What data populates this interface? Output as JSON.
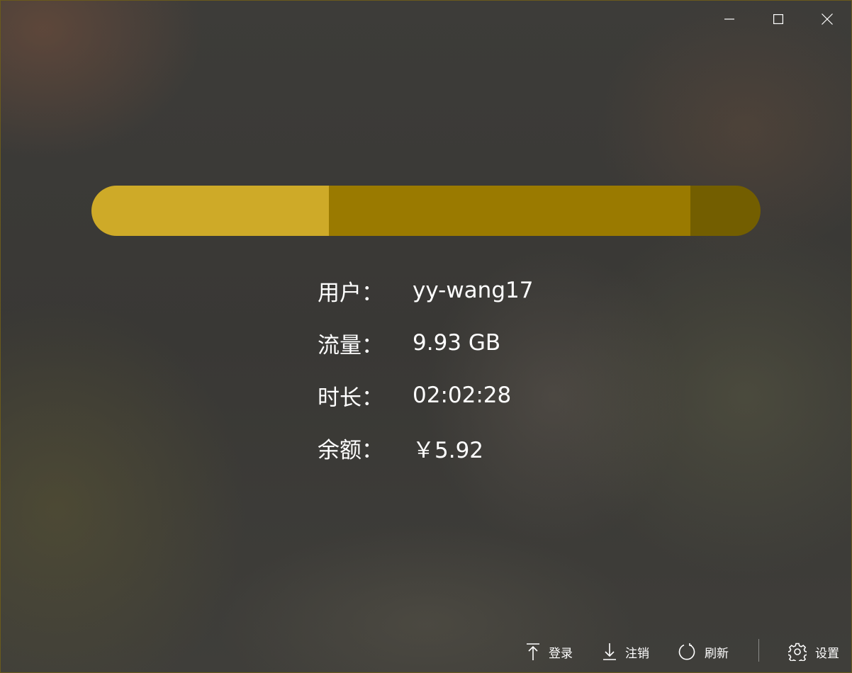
{
  "window": {
    "controls": [
      "minimize-icon",
      "maximize-icon",
      "close-icon"
    ]
  },
  "usage_bar": {
    "colors": [
      "#ceaa28",
      "#9a7a00",
      "#735e00"
    ],
    "segments": [
      0.355,
      0.54,
      0.105
    ]
  },
  "info": {
    "user_label": "用户：",
    "user_value": "yy-wang17",
    "traffic_label": "流量：",
    "traffic_value": "9.93 GB",
    "duration_label": "时长：",
    "duration_value": "02:02:28",
    "balance_label": "余额：",
    "balance_value": "￥5.92"
  },
  "toolbar": {
    "login_label": "登录",
    "login_icon": "arrow-up-icon",
    "logout_label": "注销",
    "logout_icon": "arrow-down-icon",
    "refresh_label": "刷新",
    "refresh_icon": "refresh-icon",
    "settings_label": "设置",
    "settings_icon": "gear-icon"
  }
}
